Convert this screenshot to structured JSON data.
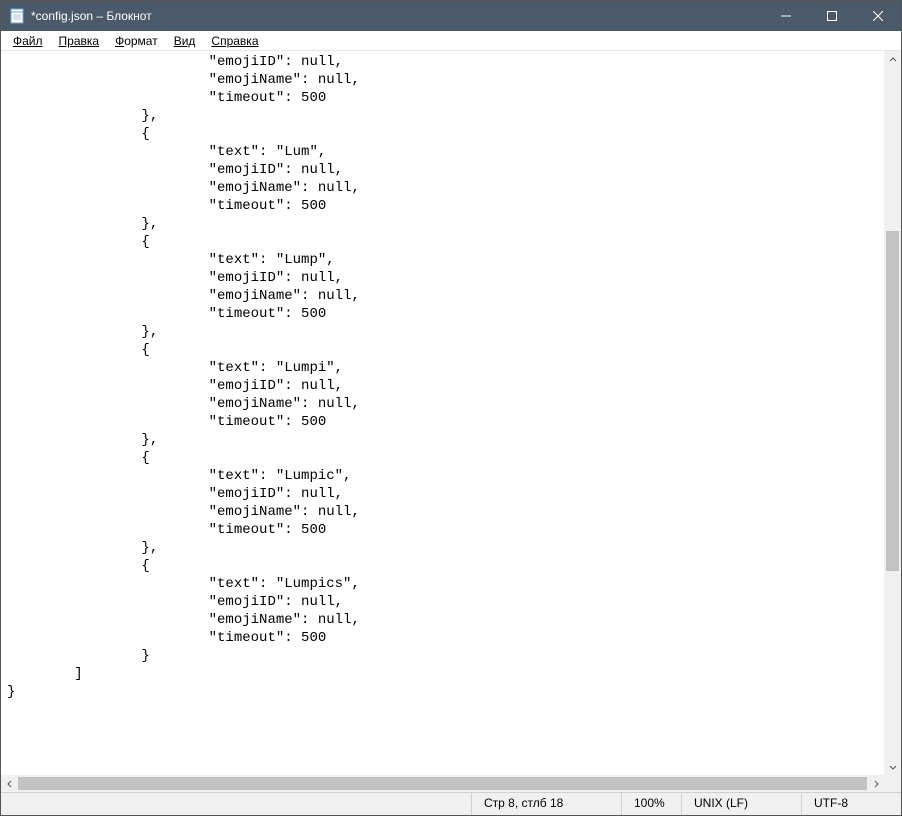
{
  "window": {
    "title": "*config.json – Блокнот"
  },
  "menu": {
    "file": "Файл",
    "edit": "Правка",
    "format": "Формат",
    "view": "Вид",
    "help": "Справка"
  },
  "editor": {
    "content": "                        \"emojiID\": null,\n                        \"emojiName\": null,\n                        \"timeout\": 500\n                },\n                {\n                        \"text\": \"Lum\",\n                        \"emojiID\": null,\n                        \"emojiName\": null,\n                        \"timeout\": 500\n                },\n                {\n                        \"text\": \"Lump\",\n                        \"emojiID\": null,\n                        \"emojiName\": null,\n                        \"timeout\": 500\n                },\n                {\n                        \"text\": \"Lumpi\",\n                        \"emojiID\": null,\n                        \"emojiName\": null,\n                        \"timeout\": 500\n                },\n                {\n                        \"text\": \"Lumpic\",\n                        \"emojiID\": null,\n                        \"emojiName\": null,\n                        \"timeout\": 500\n                },\n                {\n                        \"text\": \"Lumpics\",\n                        \"emojiID\": null,\n                        \"emojiName\": null,\n                        \"timeout\": 500\n                }\n        ]\n}"
  },
  "status": {
    "position": "Стр 8, стлб 18",
    "zoom": "100%",
    "eol": "UNIX (LF)",
    "encoding": "UTF-8"
  }
}
